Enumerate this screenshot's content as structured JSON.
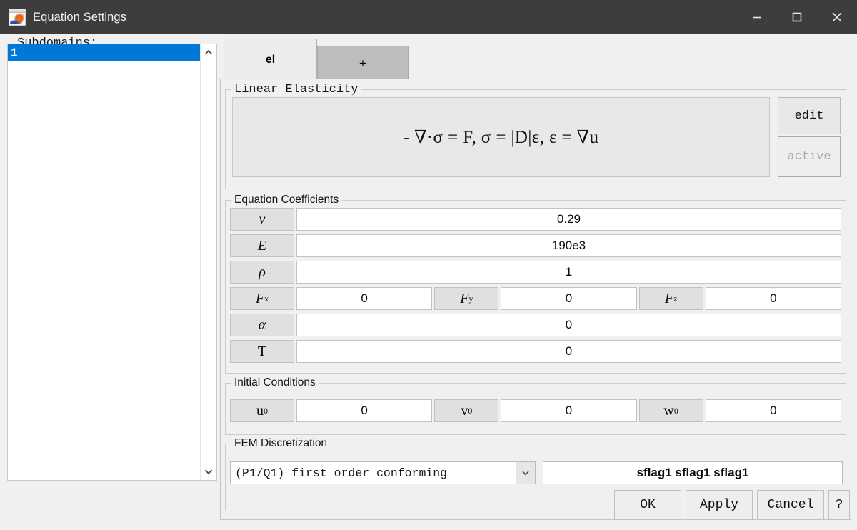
{
  "window": {
    "title": "Equation Settings",
    "app_icon": "matlab-membrane-icon",
    "controls": {
      "minimize": "minimize-icon",
      "maximize": "maximize-icon",
      "close": "close-icon"
    }
  },
  "sidebar": {
    "legend": "Subdomains:",
    "items": [
      {
        "label": "1",
        "selected": true
      }
    ],
    "scroll_up": "chevron-up-icon",
    "scroll_down": "chevron-down-icon"
  },
  "tabs": [
    {
      "label": "el",
      "active": true
    },
    {
      "label": "+",
      "active": false
    }
  ],
  "equation_section": {
    "legend": "Linear Elasticity",
    "equation": "- ∇·σ = F,  σ = |D|ε,  ε = ∇u",
    "edit_label": "edit",
    "active_label": "active"
  },
  "coefficients": {
    "legend": "Equation Coefficients",
    "rows": [
      {
        "label": "ν",
        "value": "0.29"
      },
      {
        "label": "E",
        "value": "190e3"
      },
      {
        "label": "ρ",
        "value": "1"
      },
      {
        "label": "α",
        "value": "0"
      },
      {
        "label": "T",
        "value": "0"
      }
    ],
    "force_row": [
      {
        "label": "F",
        "sub": "x",
        "value": "0"
      },
      {
        "label": "F",
        "sub": "y",
        "value": "0"
      },
      {
        "label": "F",
        "sub": "z",
        "value": "0"
      }
    ]
  },
  "initial_conditions": {
    "legend": "Initial Conditions",
    "fields": [
      {
        "label": "u",
        "sub": "0",
        "value": "0"
      },
      {
        "label": "v",
        "sub": "0",
        "value": "0"
      },
      {
        "label": "w",
        "sub": "0",
        "value": "0"
      }
    ]
  },
  "fem": {
    "legend": "FEM Discretization",
    "select_value": "(P1/Q1) first order conforming",
    "flags_value": "sflag1 sflag1 sflag1"
  },
  "footer": {
    "ok": "OK",
    "apply": "Apply",
    "cancel": "Cancel",
    "help": "?"
  },
  "colors": {
    "titlebar": "#3d3d3d",
    "dialog_bg": "#f0f0f0",
    "selection": "#0078d7",
    "tab_active": "#ececec",
    "tab_inactive": "#bdbdbd",
    "field_bg": "#ffffff",
    "label_bg": "#e0e0e0"
  }
}
